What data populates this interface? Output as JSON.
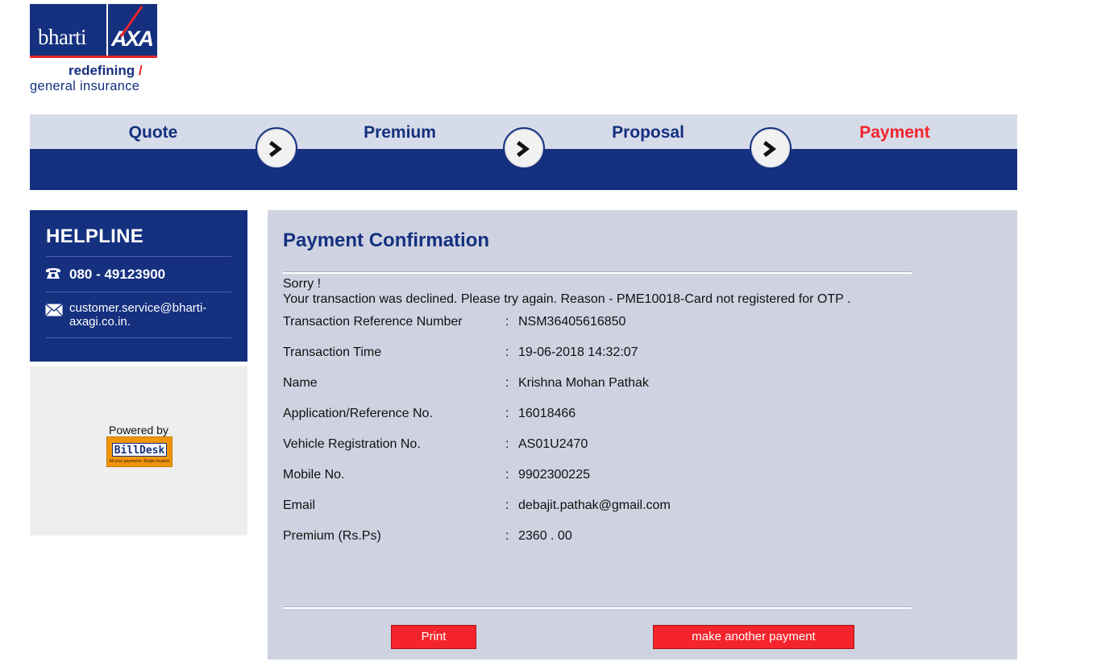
{
  "brand": {
    "name": "bharti",
    "partner": "AXA",
    "tagline_line1": "redefining",
    "tagline_line2": "general insurance",
    "colors": {
      "navy": "#14307f",
      "red": "#e8252b"
    }
  },
  "steps": [
    {
      "label": "Quote",
      "active": false
    },
    {
      "label": "Premium",
      "active": false
    },
    {
      "label": "Proposal",
      "active": false
    },
    {
      "label": "Payment",
      "active": true
    }
  ],
  "helpline": {
    "title": "HELPLINE",
    "phone_icon": "phone-icon",
    "phone": "080 - 49123900",
    "mail_icon": "mail-icon",
    "email": "customer.service@bharti-axagi.co.in."
  },
  "powered_by": {
    "label": "Powered by",
    "logo_text": "BillDesk",
    "logo_tagline": "All your payments. Single location"
  },
  "confirmation": {
    "title": "Payment Confirmation",
    "sorry": "Sorry !",
    "message": "Your transaction was declined. Please try again. Reason - PME10018-Card not registered for OTP .",
    "rows": [
      {
        "label": "Transaction Reference Number",
        "value": "NSM36405616850"
      },
      {
        "label": "Transaction Time",
        "value": "19-06-2018 14:32:07"
      },
      {
        "label": "Name",
        "value": "Krishna Mohan Pathak"
      },
      {
        "label": "Application/Reference No.",
        "value": "16018466"
      },
      {
        "label": "Vehicle Registration No.",
        "value": "AS01U2470"
      },
      {
        "label": "Mobile No.",
        "value": "9902300225"
      },
      {
        "label": "Email",
        "value": "debajit.pathak@gmail.com"
      },
      {
        "label": "Premium (Rs.Ps)",
        "value": "2360 . 00"
      }
    ],
    "colon": ":",
    "print_label": "Print",
    "another_label": "make another payment"
  }
}
